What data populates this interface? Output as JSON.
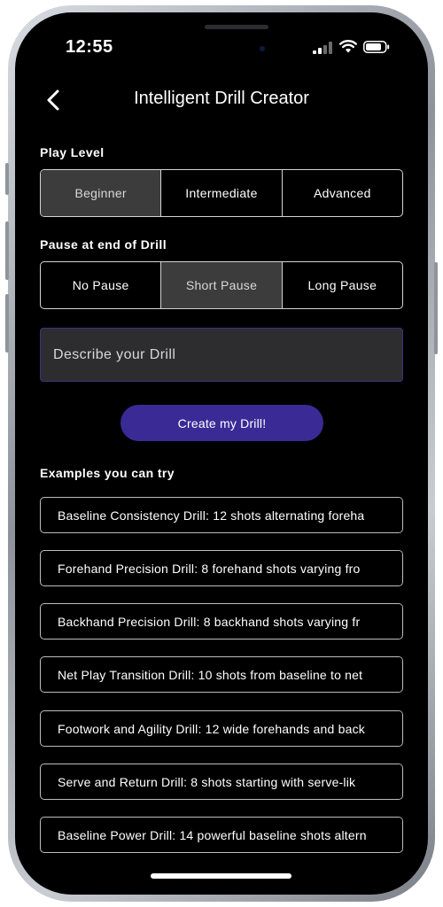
{
  "status_bar": {
    "time": "12:55"
  },
  "header": {
    "title": "Intelligent Drill Creator",
    "back_icon": "chevron-left-icon"
  },
  "play_level": {
    "label": "Play Level",
    "options": [
      "Beginner",
      "Intermediate",
      "Advanced"
    ],
    "selected": "Beginner"
  },
  "pause": {
    "label": "Pause at end of Drill",
    "options": [
      "No Pause",
      "Short Pause",
      "Long Pause"
    ],
    "selected": "Short Pause"
  },
  "describe": {
    "placeholder": "Describe your Drill",
    "value": ""
  },
  "create_button": {
    "label": "Create my Drill!",
    "color": "#3a2a96"
  },
  "examples": {
    "label": "Examples you can try",
    "items": [
      "Baseline Consistency Drill: 12 shots alternating foreha",
      "Forehand Precision Drill: 8 forehand shots varying fro",
      "Backhand Precision Drill: 8 backhand shots varying fr",
      "Net Play Transition Drill: 10 shots from baseline to net",
      "Footwork and Agility Drill: 12 wide forehands and back",
      "Serve and Return Drill: 8 shots starting with serve-lik",
      "Baseline Power Drill: 14 powerful baseline shots altern"
    ]
  },
  "colors": {
    "background": "#000000",
    "segment_selected": "#3c3c3c",
    "input_background": "#2d2d2f",
    "accent": "#3a2a96"
  }
}
